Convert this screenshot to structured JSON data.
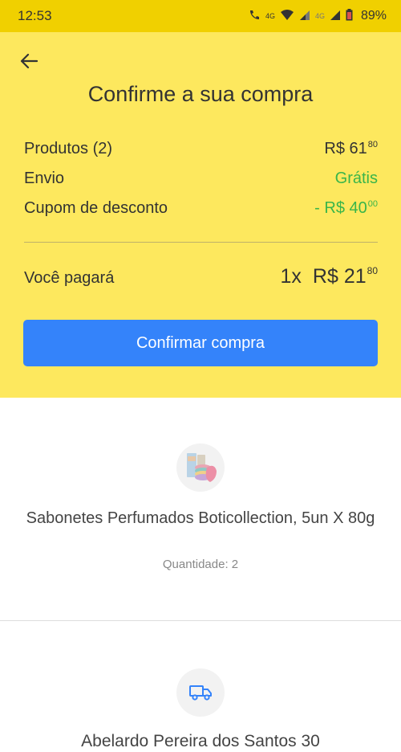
{
  "status_bar": {
    "time": "12:53",
    "network_1": "4G",
    "network_2": "4G",
    "battery": "89%"
  },
  "header": {
    "title": "Confirme a sua compra",
    "background_color": "#fde85e"
  },
  "summary": {
    "products_label": "Produtos (2)",
    "products_value_main": "R$ 61",
    "products_value_cents": "80",
    "shipping_label": "Envio",
    "shipping_value": "Grátis",
    "coupon_label": "Cupom de desconto",
    "coupon_value_main": "- R$ 40",
    "coupon_value_cents": "00"
  },
  "payment": {
    "label": "Você pagará",
    "installments": "1x",
    "amount_main": "R$ 21",
    "amount_cents": "80"
  },
  "confirm_button": {
    "label": "Confirmar compra",
    "color": "#3483fa"
  },
  "product": {
    "name": "Sabonetes Perfumados Boticollection, 5un X 80g",
    "quantity": "Quantidade: 2"
  },
  "shipping": {
    "icon": "truck-icon",
    "address": "Abelardo Pereira dos Santos 30"
  },
  "colors": {
    "status_bar": "#f0d000",
    "green": "#39b54a"
  }
}
